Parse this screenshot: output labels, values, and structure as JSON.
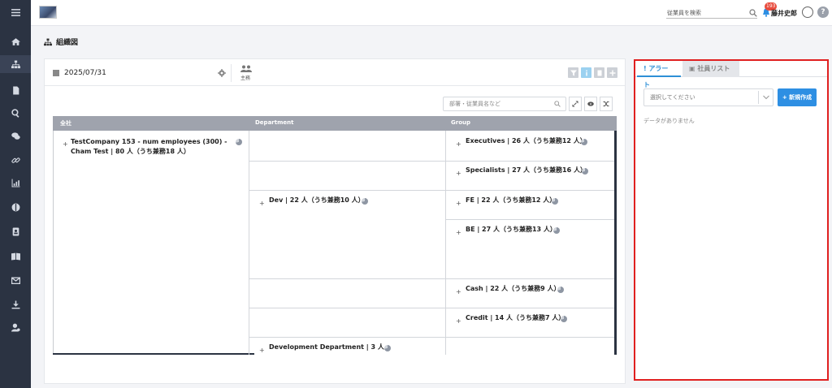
{
  "topbar": {
    "employee_search_placeholder": "従業員を検索",
    "notification_count": "193",
    "user_name": "藤井史郎",
    "help_label": "?"
  },
  "page": {
    "title": "組織図"
  },
  "toolbar": {
    "date": "2025/07/31",
    "mode_label": "主務"
  },
  "filter": {
    "placeholder": "部署・従業員名など"
  },
  "org_table": {
    "headers": [
      "全社",
      "Department",
      "Group"
    ],
    "company": "TestCompany 153 - num employees (300) - Cham Test | 80 人（うち兼務18 人）",
    "departments": [
      "Dev | 22 人（うち兼務10 人）",
      "Development Department | 3 人"
    ],
    "groups": [
      "Executives | 26 人（うち兼務12 人）",
      "Specialists | 27 人（うち兼務16 人）",
      "FE | 22 人（うち兼務12 人）",
      "BE | 27 人（うち兼務13 人）",
      "Cash | 22 人（うち兼務9 人）",
      "Credit | 14 人（うち兼務7 人）"
    ]
  },
  "right_panel": {
    "tabs": [
      {
        "label": "アラート"
      },
      {
        "label": "社員リスト"
      }
    ],
    "select_placeholder": "選択してください",
    "new_button": "+ 新規作成",
    "empty_text": "データがありません"
  },
  "colors": {
    "sidebar_bg": "#2b3342",
    "accent_blue": "#2e8fe3",
    "highlight_red": "#e02020",
    "table_header": "#9fa3ad"
  }
}
